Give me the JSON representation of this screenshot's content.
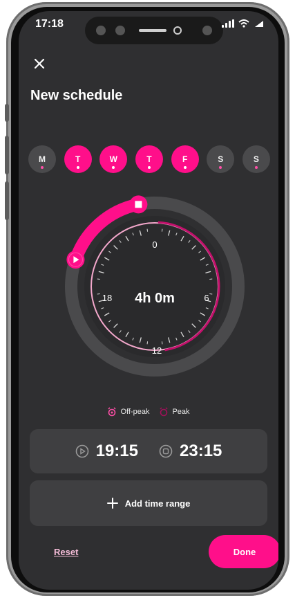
{
  "status_bar": {
    "time": "17:18"
  },
  "header": {
    "title": "New schedule"
  },
  "days": [
    {
      "label": "M",
      "active": false
    },
    {
      "label": "T",
      "active": true
    },
    {
      "label": "W",
      "active": true
    },
    {
      "label": "T",
      "active": true
    },
    {
      "label": "F",
      "active": true
    },
    {
      "label": "S",
      "active": false
    },
    {
      "label": "S",
      "active": false
    }
  ],
  "dial": {
    "duration": "4h 0m",
    "hour_labels": {
      "top": "0",
      "right": "6",
      "bottom": "12",
      "left": "18"
    },
    "start_hour": 19.25,
    "end_hour": 23.25
  },
  "legend": {
    "off_peak": "Off-peak",
    "peak": "Peak"
  },
  "time_range": {
    "start": "19:15",
    "end": "23:15"
  },
  "add_range_label": "Add time range",
  "footer": {
    "reset_label": "Reset",
    "done_label": "Done"
  },
  "colors": {
    "accent": "#ff0f8a",
    "accent_light": "#f4a8cc",
    "background": "#2f2f31",
    "card": "#3f3f41"
  }
}
